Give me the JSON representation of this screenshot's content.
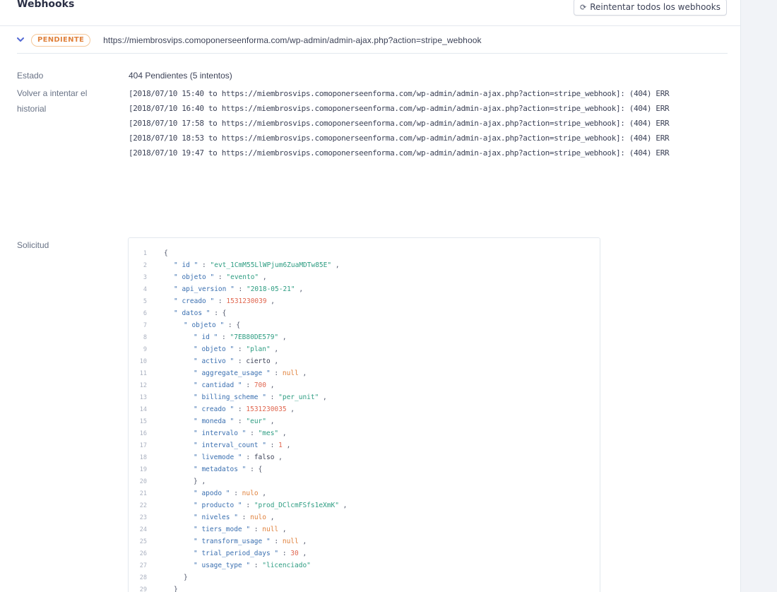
{
  "header": {
    "title": "Webhooks",
    "retry_all_label": "Reintentar todos los webhooks",
    "retry_icon": "retry-icon"
  },
  "webhook": {
    "status_badge": "PENDIENTE",
    "url": "https://miembrosvips.comoponerseenforma.com/wp-admin/admin-ajax.php?action=stripe_webhook"
  },
  "details": {
    "status_label": "Estado",
    "status_value": "404 Pendientes (5 intentos)",
    "history_label": "Volver a intentar el historial",
    "history": [
      "[2018/07/10 15:40 to https://miembrosvips.comoponerseenforma.com/wp-admin/admin-ajax.php?action=stripe_webhook]: (404) ERR",
      "[2018/07/10 16:40 to https://miembrosvips.comoponerseenforma.com/wp-admin/admin-ajax.php?action=stripe_webhook]: (404) ERR",
      "[2018/07/10 17:58 to https://miembrosvips.comoponerseenforma.com/wp-admin/admin-ajax.php?action=stripe_webhook]: (404) ERR",
      "[2018/07/10 18:53 to https://miembrosvips.comoponerseenforma.com/wp-admin/admin-ajax.php?action=stripe_webhook]: (404) ERR",
      "[2018/07/10 19:47 to https://miembrosvips.comoponerseenforma.com/wp-admin/admin-ajax.php?action=stripe_webhook]: (404) ERR"
    ],
    "request_label": "Solicitud"
  },
  "request_json": [
    {
      "n": "1",
      "i": 0,
      "t": [
        [
          "p",
          "{"
        ]
      ]
    },
    {
      "n": "2",
      "i": 1,
      "t": [
        [
          "k",
          "\" id \""
        ],
        [
          "p",
          " : "
        ],
        [
          "s",
          "\"evt_1CmM55LlWPjum6ZuaMDTw85E\""
        ],
        [
          "p",
          " ,"
        ]
      ]
    },
    {
      "n": "3",
      "i": 1,
      "t": [
        [
          "k",
          "\" objeto \""
        ],
        [
          "p",
          " : "
        ],
        [
          "s",
          "\"evento\""
        ],
        [
          "p",
          " ,"
        ]
      ]
    },
    {
      "n": "4",
      "i": 1,
      "t": [
        [
          "k",
          "\" api_version \""
        ],
        [
          "p",
          " : "
        ],
        [
          "s",
          "\"2018-05-21\""
        ],
        [
          "p",
          " ,"
        ]
      ]
    },
    {
      "n": "5",
      "i": 1,
      "t": [
        [
          "k",
          "\" creado \""
        ],
        [
          "p",
          " : "
        ],
        [
          "n",
          "1531230039"
        ],
        [
          "p",
          " ,"
        ]
      ]
    },
    {
      "n": "6",
      "i": 1,
      "t": [
        [
          "k",
          "\" datos \""
        ],
        [
          "p",
          " : {"
        ]
      ]
    },
    {
      "n": "7",
      "i": 2,
      "t": [
        [
          "k",
          "\" objeto \""
        ],
        [
          "p",
          " : {"
        ]
      ]
    },
    {
      "n": "8",
      "i": 3,
      "t": [
        [
          "k",
          "\" id \""
        ],
        [
          "p",
          " : "
        ],
        [
          "s",
          "\"7EB80DE579\""
        ],
        [
          "p",
          " ,"
        ]
      ]
    },
    {
      "n": "9",
      "i": 3,
      "t": [
        [
          "k",
          "\" objeto \""
        ],
        [
          "p",
          " : "
        ],
        [
          "s",
          "\"plan\""
        ],
        [
          "p",
          " ,"
        ]
      ]
    },
    {
      "n": "10",
      "i": 3,
      "t": [
        [
          "k",
          "\" activo \""
        ],
        [
          "p",
          " : "
        ],
        [
          "bool",
          "cierto"
        ],
        [
          "p",
          " ,"
        ]
      ]
    },
    {
      "n": "11",
      "i": 3,
      "t": [
        [
          "k",
          "\" aggregate_usage \""
        ],
        [
          "p",
          " : "
        ],
        [
          "lit",
          "null"
        ],
        [
          "p",
          " ,"
        ]
      ]
    },
    {
      "n": "12",
      "i": 3,
      "t": [
        [
          "k",
          "\" cantidad \""
        ],
        [
          "p",
          " : "
        ],
        [
          "n",
          "700"
        ],
        [
          "p",
          " ,"
        ]
      ]
    },
    {
      "n": "13",
      "i": 3,
      "t": [
        [
          "k",
          "\" billing_scheme \""
        ],
        [
          "p",
          " : "
        ],
        [
          "s",
          "\"per_unit\""
        ],
        [
          "p",
          " ,"
        ]
      ]
    },
    {
      "n": "14",
      "i": 3,
      "t": [
        [
          "k",
          "\" creado \""
        ],
        [
          "p",
          " : "
        ],
        [
          "n",
          "1531230035"
        ],
        [
          "p",
          " ,"
        ]
      ]
    },
    {
      "n": "15",
      "i": 3,
      "t": [
        [
          "k",
          "\" moneda \""
        ],
        [
          "p",
          " : "
        ],
        [
          "s",
          "\"eur\""
        ],
        [
          "p",
          " ,"
        ]
      ]
    },
    {
      "n": "16",
      "i": 3,
      "t": [
        [
          "k",
          "\" intervalo \""
        ],
        [
          "p",
          " : "
        ],
        [
          "s",
          "\"mes\""
        ],
        [
          "p",
          " ,"
        ]
      ]
    },
    {
      "n": "17",
      "i": 3,
      "t": [
        [
          "k",
          "\" interval_count \""
        ],
        [
          "p",
          " : "
        ],
        [
          "n",
          "1"
        ],
        [
          "p",
          " ,"
        ]
      ]
    },
    {
      "n": "18",
      "i": 3,
      "t": [
        [
          "k",
          "\" livemode \""
        ],
        [
          "p",
          " : "
        ],
        [
          "bool",
          "falso"
        ],
        [
          "p",
          " ,"
        ]
      ]
    },
    {
      "n": "19",
      "i": 3,
      "t": [
        [
          "k",
          "\" metadatos \""
        ],
        [
          "p",
          " : {"
        ]
      ]
    },
    {
      "n": "20",
      "i": 3,
      "t": [
        [
          "p",
          "} ,"
        ]
      ]
    },
    {
      "n": "21",
      "i": 3,
      "t": [
        [
          "k",
          "\" apodo \""
        ],
        [
          "p",
          " : "
        ],
        [
          "lit",
          "nulo"
        ],
        [
          "p",
          " ,"
        ]
      ]
    },
    {
      "n": "22",
      "i": 3,
      "t": [
        [
          "k",
          "\" producto \""
        ],
        [
          "p",
          " : "
        ],
        [
          "s",
          "\"prod_DClcmFSfs1eXmK\""
        ],
        [
          "p",
          " ,"
        ]
      ]
    },
    {
      "n": "23",
      "i": 3,
      "t": [
        [
          "k",
          "\" niveles \""
        ],
        [
          "p",
          " : "
        ],
        [
          "lit",
          "nulo"
        ],
        [
          "p",
          " ,"
        ]
      ]
    },
    {
      "n": "24",
      "i": 3,
      "t": [
        [
          "k",
          "\" tiers_mode \""
        ],
        [
          "p",
          " : "
        ],
        [
          "lit",
          "null"
        ],
        [
          "p",
          " ,"
        ]
      ]
    },
    {
      "n": "25",
      "i": 3,
      "t": [
        [
          "k",
          "\" transform_usage \""
        ],
        [
          "p",
          " : "
        ],
        [
          "lit",
          "null"
        ],
        [
          "p",
          " ,"
        ]
      ]
    },
    {
      "n": "26",
      "i": 3,
      "t": [
        [
          "k",
          "\" trial_period_days \""
        ],
        [
          "p",
          " : "
        ],
        [
          "n",
          "30"
        ],
        [
          "p",
          " ,"
        ]
      ]
    },
    {
      "n": "27",
      "i": 3,
      "t": [
        [
          "k",
          "\" usage_type \""
        ],
        [
          "p",
          " : "
        ],
        [
          "s",
          "\"licenciado\""
        ]
      ]
    },
    {
      "n": "28",
      "i": 2,
      "t": [
        [
          "p",
          "}"
        ]
      ]
    },
    {
      "n": "29",
      "i": 1,
      "t": [
        [
          "p",
          "}"
        ]
      ]
    }
  ]
}
